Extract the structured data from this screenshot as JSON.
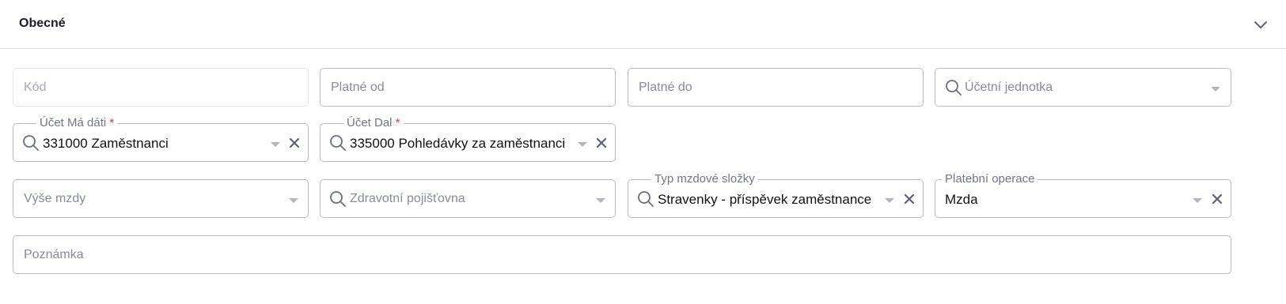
{
  "section": {
    "title": "Obecné"
  },
  "fields": {
    "kod": {
      "placeholder": "Kód"
    },
    "platne_od": {
      "placeholder": "Platné od"
    },
    "platne_do": {
      "placeholder": "Platné do"
    },
    "ucetni_jednotka": {
      "placeholder": "Účetní jednotka"
    },
    "ucet_ma_dati": {
      "label": "Účet Má dáti",
      "required_mark": "*",
      "value": "331000 Zaměstnanci"
    },
    "ucet_dal": {
      "label": "Účet Dal",
      "required_mark": "*",
      "value": "335000 Pohledávky za zaměstnanci"
    },
    "vyse_mzdy": {
      "placeholder": "Výše mzdy"
    },
    "zdravotni_pojistovna": {
      "placeholder": "Zdravotní pojišťovna"
    },
    "typ_mzdove_slozky": {
      "label": "Typ mzdové složky",
      "value": "Stravenky - příspěvek zaměstnance"
    },
    "platebni_operace": {
      "label": "Platební operace",
      "value": "Mzda"
    },
    "poznamka": {
      "placeholder": "Poznámka"
    }
  },
  "icons": {
    "search": "search-icon",
    "dropdown": "chevron-down-icon",
    "clear": "close-icon",
    "collapse": "chevron-down-icon"
  },
  "colors": {
    "required": "#e03a3a",
    "border": "#b9bcc7",
    "placeholder": "#888b98"
  }
}
